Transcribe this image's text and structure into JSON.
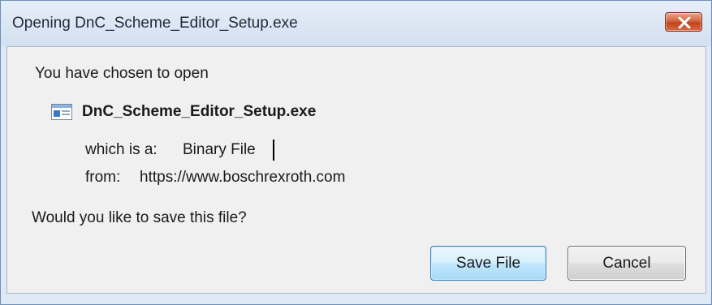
{
  "window": {
    "title": "Opening DnC_Scheme_Editor_Setup.exe"
  },
  "dialog": {
    "intro": "You have chosen to open",
    "file_name": "DnC_Scheme_Editor_Setup.exe",
    "file_icon": "executable-window-icon",
    "type_label": "which is a:",
    "type_value": "Binary File",
    "from_label": "from:",
    "from_value": "https://www.boschrexroth.com",
    "question": "Would you like to save this file?"
  },
  "buttons": {
    "save_label": "Save File",
    "cancel_label": "Cancel"
  },
  "colors": {
    "close_button": "#c2431f",
    "save_button_border": "#3c7fb1",
    "title_bar": "#dfe9f5"
  }
}
